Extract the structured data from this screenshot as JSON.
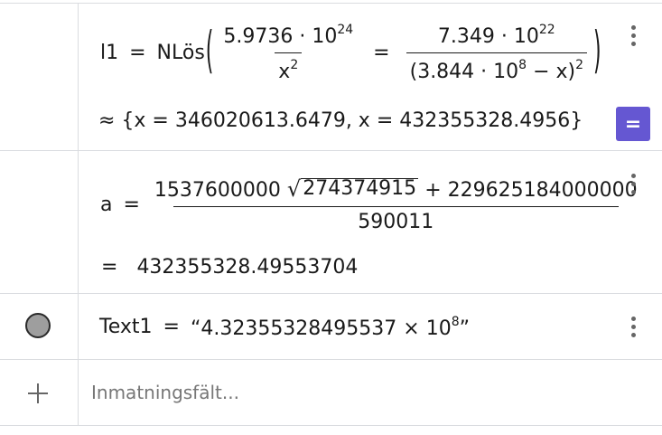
{
  "rows": [
    {
      "lhs": "l1",
      "cmd": "NLös",
      "left_frac": {
        "num_base": "5.9736 · 10",
        "num_exp": "24",
        "den_base": "x",
        "den_exp": "2"
      },
      "right_frac": {
        "num_base": "7.349 · 10",
        "num_exp": "22",
        "den_inner": "(3.844 · 10",
        "den_inner_exp": "8",
        "den_tail": " − x)",
        "den_exp": "2"
      },
      "result": "≈ {x  =  346020613.6479,  x  =  432355328.4956}",
      "eq_button": "="
    },
    {
      "lhs": "a",
      "num_coef": "1537600000",
      "sqrt_radicand": "274374915",
      "num_add": "+ 229625184000000",
      "den": "590011",
      "result_eq": "=",
      "result_value": "432355328.49553704"
    },
    {
      "lhs": "Text1",
      "value": "“4.32355328495537 × 10",
      "exp": "8",
      "close_quote": "”"
    }
  ],
  "input": {
    "placeholder": "Inmatningsfält...",
    "value": ""
  },
  "colors": {
    "eq_button": "#6557d2",
    "divider": "#dadce0"
  }
}
